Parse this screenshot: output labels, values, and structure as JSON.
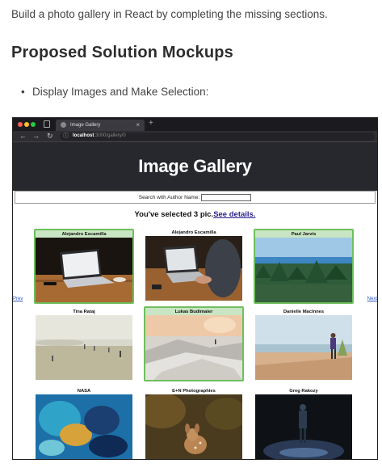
{
  "doc": {
    "intro": "Build a photo gallery in React by completing the missing sections.",
    "heading": "Proposed Solution Mockups",
    "bullet": "Display Images and Make Selection:"
  },
  "browser": {
    "tab_title": "Image Gallery",
    "new_tab": "+",
    "close": "×",
    "url_host": "localhost",
    "url_path": ":3000/gallery/0",
    "back": "←",
    "forward": "→",
    "reload": "↻",
    "info": "ⓘ"
  },
  "app": {
    "title": "Image Gallery",
    "search_label": "Search with Author Name:",
    "search_value": "",
    "selected_text": "You've selected 3 pic.",
    "details_link": "See details.",
    "prev": "Prev",
    "next": "Next"
  },
  "photos": [
    {
      "author": "Alejandro Escamilla",
      "selected": true
    },
    {
      "author": "Alejandro Escamilla",
      "selected": false
    },
    {
      "author": "Paul Jarvis",
      "selected": true
    },
    {
      "author": "Tina Rataj",
      "selected": false
    },
    {
      "author": "Lukas Budimaier",
      "selected": true
    },
    {
      "author": "Danielle MacInnes",
      "selected": false
    },
    {
      "author": "NASA",
      "selected": false
    },
    {
      "author": "E+N Photographies",
      "selected": false
    },
    {
      "author": "Greg Rakozy",
      "selected": false
    }
  ],
  "colors": {
    "header_bg": "#26282e",
    "selected_bg": "#c9e5c3",
    "selected_border": "#6fbf5e",
    "link": "#2a1f8c"
  }
}
